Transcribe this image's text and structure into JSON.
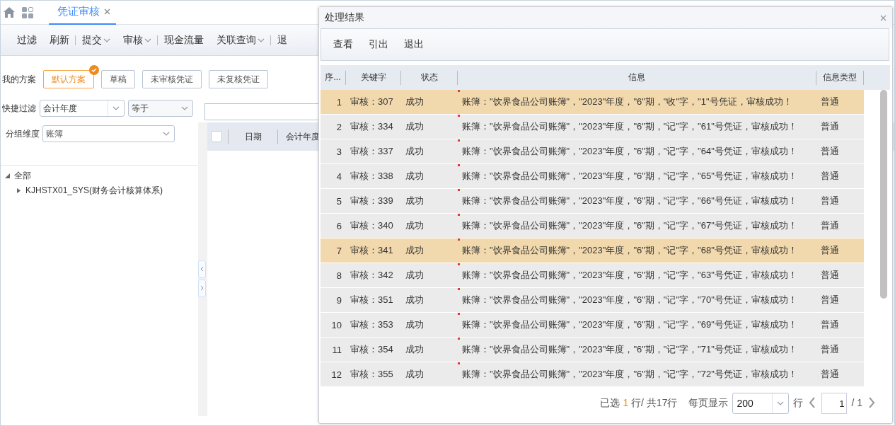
{
  "tabs": [
    {
      "label": "凭证审核",
      "selected": true
    }
  ],
  "toolbar": [
    {
      "label": "过滤",
      "dropdown": false,
      "separator_after": false
    },
    {
      "label": "刷新",
      "dropdown": false,
      "separator_after": true
    },
    {
      "label": "提交",
      "dropdown": true,
      "separator_after": false
    },
    {
      "label": "审核",
      "dropdown": true,
      "separator_after": true
    },
    {
      "label": "现金流量",
      "dropdown": false,
      "separator_after": false
    },
    {
      "label": "关联查询",
      "dropdown": true,
      "separator_after": true
    },
    {
      "label": "退",
      "dropdown": false,
      "separator_after": false
    }
  ],
  "schemes": {
    "label": "我的方案",
    "items": [
      {
        "label": "默认方案",
        "selected": true
      },
      {
        "label": "草稿",
        "selected": false
      },
      {
        "label": "未审核凭证",
        "selected": false
      },
      {
        "label": "未复核凭证",
        "selected": false
      }
    ]
  },
  "quick_filter": {
    "label": "快捷过滤",
    "field": "会计年度",
    "operator": "等于"
  },
  "grouping": {
    "label": "分组维度",
    "value": "账簿"
  },
  "tree": [
    {
      "label": "全部",
      "expanded": true,
      "children": [
        {
          "label": "KJHSTX01_SYS(财务会计核算体系)",
          "expanded": false
        }
      ]
    }
  ],
  "grid": {
    "select_all_checked": false,
    "columns": [
      "日期",
      "会计年度"
    ]
  },
  "dialog": {
    "title": "处理结果",
    "buttons": [
      "查看",
      "引出",
      "退出"
    ],
    "columns": [
      "序...",
      "关键字",
      "状态",
      "信息",
      "信息类型"
    ],
    "rows": [
      {
        "no": "1",
        "key": "审核：307",
        "status": "成功",
        "info": "账簿：\"饮界食品公司账簿\"，\"2023\"年度，\"6\"期，\"收\"字，\"1\"号凭证，审核成功！",
        "type": "普通",
        "selected": true
      },
      {
        "no": "2",
        "key": "审核：334",
        "status": "成功",
        "info": "账簿：\"饮界食品公司账簿\"，\"2023\"年度，\"6\"期，\"记\"字，\"61\"号凭证，审核成功！",
        "type": "普通",
        "selected": false
      },
      {
        "no": "3",
        "key": "审核：337",
        "status": "成功",
        "info": "账簿：\"饮界食品公司账簿\"，\"2023\"年度，\"6\"期，\"记\"字，\"64\"号凭证，审核成功！",
        "type": "普通",
        "selected": false
      },
      {
        "no": "4",
        "key": "审核：338",
        "status": "成功",
        "info": "账簿：\"饮界食品公司账簿\"，\"2023\"年度，\"6\"期，\"记\"字，\"65\"号凭证，审核成功！",
        "type": "普通",
        "selected": false
      },
      {
        "no": "5",
        "key": "审核：339",
        "status": "成功",
        "info": "账簿：\"饮界食品公司账簿\"，\"2023\"年度，\"6\"期，\"记\"字，\"66\"号凭证，审核成功！",
        "type": "普通",
        "selected": false
      },
      {
        "no": "6",
        "key": "审核：340",
        "status": "成功",
        "info": "账簿：\"饮界食品公司账簿\"，\"2023\"年度，\"6\"期，\"记\"字，\"67\"号凭证，审核成功！",
        "type": "普通",
        "selected": false
      },
      {
        "no": "7",
        "key": "审核：341",
        "status": "成功",
        "info": "账簿：\"饮界食品公司账簿\"，\"2023\"年度，\"6\"期，\"记\"字，\"68\"号凭证，审核成功！",
        "type": "普通",
        "selected": true
      },
      {
        "no": "8",
        "key": "审核：342",
        "status": "成功",
        "info": "账簿：\"饮界食品公司账簿\"，\"2023\"年度，\"6\"期，\"记\"字，\"63\"号凭证，审核成功！",
        "type": "普通",
        "selected": false
      },
      {
        "no": "9",
        "key": "审核：351",
        "status": "成功",
        "info": "账簿：\"饮界食品公司账簿\"，\"2023\"年度，\"6\"期，\"记\"字，\"70\"号凭证，审核成功！",
        "type": "普通",
        "selected": false
      },
      {
        "no": "10",
        "key": "审核：353",
        "status": "成功",
        "info": "账簿：\"饮界食品公司账簿\"，\"2023\"年度，\"6\"期，\"记\"字，\"69\"号凭证，审核成功！",
        "type": "普通",
        "selected": false
      },
      {
        "no": "11",
        "key": "审核：354",
        "status": "成功",
        "info": "账簿：\"饮界食品公司账簿\"，\"2023\"年度，\"6\"期，\"记\"字，\"71\"号凭证，审核成功！",
        "type": "普通",
        "selected": false
      },
      {
        "no": "12",
        "key": "审核：355",
        "status": "成功",
        "info": "账簿：\"饮界食品公司账簿\"，\"2023\"年度，\"6\"期，\"记\"字，\"72\"号凭证，审核成功！",
        "type": "普通",
        "selected": false
      }
    ],
    "footer": {
      "selected_prefix": "已选",
      "selected_count": "1",
      "selected_suffix": "行/ 共17行",
      "page_size_label": "每页显示",
      "page_size": "200",
      "rows_unit": "行",
      "page": "1",
      "page_total": "/ 1"
    }
  }
}
